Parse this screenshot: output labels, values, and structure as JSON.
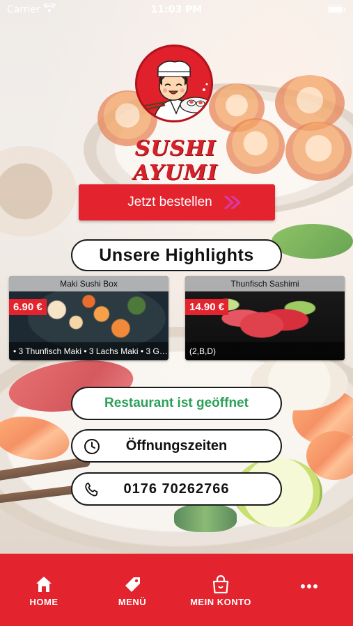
{
  "status_bar": {
    "carrier": "Carrier",
    "time": "11:03 PM"
  },
  "brand": {
    "name": "SUSHI AYUMI",
    "accent_color": "#e3232d"
  },
  "order_button": {
    "label": "Jetzt bestellen"
  },
  "highlights": {
    "title": "Unsere Highlights",
    "items": [
      {
        "title": "Maki Sushi Box",
        "price": "6.90 €",
        "description": "• 3 Thunfisch Maki • 3 Lachs Maki • 3 Gur..."
      },
      {
        "title": "Thunfisch Sashimi",
        "price": "14.90 €",
        "description": "(2,B,D)"
      }
    ]
  },
  "restaurant_status": {
    "label": "Restaurant ist geöffnet",
    "color": "#2aa05a"
  },
  "opening_hours": {
    "label": "Öffnungszeiten",
    "icon": "clock-icon"
  },
  "phone": {
    "number": "0176 70262766",
    "icon": "phone-icon"
  },
  "tab_bar": {
    "items": [
      {
        "label": "HOME",
        "icon": "home-icon"
      },
      {
        "label": "MENÜ",
        "icon": "tag-icon"
      },
      {
        "label": "MEIN KONTO",
        "icon": "shopping-bag-icon"
      },
      {
        "label": "",
        "icon": "more-icon"
      }
    ]
  }
}
